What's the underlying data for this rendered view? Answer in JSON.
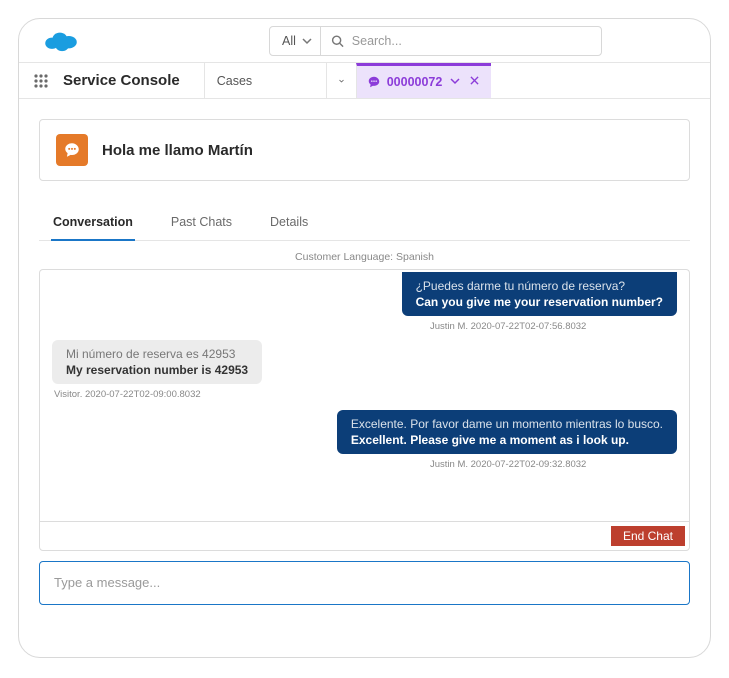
{
  "header": {
    "search_scope": "All",
    "search_placeholder": "Search..."
  },
  "nav": {
    "console": "Service Console",
    "cases_label": "Cases",
    "tab_id": "00000072"
  },
  "case": {
    "title": "Hola me llamo Martín"
  },
  "tabs": {
    "conversation": "Conversation",
    "past_chats": "Past Chats",
    "details": "Details"
  },
  "chat": {
    "language_info": "Customer Language: Spanish",
    "messages": [
      {
        "side": "right",
        "original": "¿Puedes darme tu número de reserva?",
        "translated": "Can you give me your reservation number?",
        "meta": "Justin M. 2020-07-22T02-07:56.8032",
        "cut_top": true
      },
      {
        "side": "left",
        "original": "Mi número de reserva es 42953",
        "translated": "My reservation number is 42953",
        "meta": "Visitor. 2020-07-22T02-09:00.8032"
      },
      {
        "side": "right",
        "original": "Excelente. Por favor dame un momento mientras lo busco.",
        "translated": "Excellent. Please give me a moment as i look up.",
        "meta": "Justin M. 2020-07-22T02-09:32.8032"
      }
    ],
    "end_chat": "End Chat",
    "compose_placeholder": "Type a message..."
  }
}
